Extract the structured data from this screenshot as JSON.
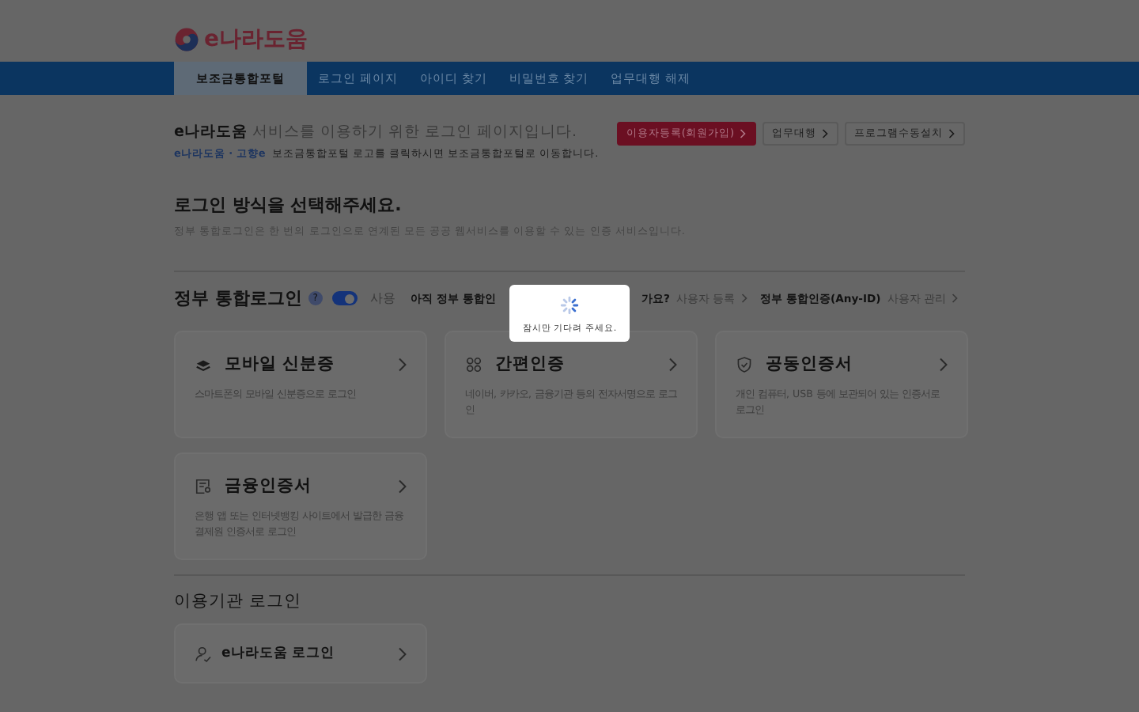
{
  "logo": {
    "text": "e나라도움"
  },
  "nav": {
    "tabs": [
      {
        "label": "보조금통합포털",
        "selected": true
      },
      {
        "label": "로그인 페이지",
        "selected": false
      },
      {
        "label": "아이디 찾기",
        "selected": false
      },
      {
        "label": "비밀번호 찾기",
        "selected": false
      },
      {
        "label": "업무대행 해제",
        "selected": false
      }
    ]
  },
  "intro": {
    "title_brand": "e나라도움",
    "title_rest": " 서비스를 이용하기 위한 로그인 페이지입니다.",
    "note_brand": "e나라도움 · 고향e",
    "note_rest": "보조금통합포털 로고를 클릭하시면 보조금통합포털로 이동합니다.",
    "buttons": [
      {
        "label": "이용자등록(회원가입)",
        "kind": "primary"
      },
      {
        "label": "업무대행",
        "kind": "plain"
      },
      {
        "label": "프로그램수동설치",
        "kind": "plain"
      }
    ]
  },
  "section": {
    "title": "로그인 방식을 선택해주세요.",
    "description": "정부 통합로그인은 한 번의 로그인으로 연계된 모든 공공 웹서비스를 이용할 수 있는 인증 서비스입니다."
  },
  "gov_login": {
    "title": "정부 통합로그인",
    "help": "?",
    "toggle_on": true,
    "toggle_label": "사용",
    "question_start": "아직 정부 통합인",
    "question_end": "가요?",
    "links": [
      {
        "label": "사용자 등록",
        "kind": "link"
      },
      {
        "label": "정부 통합인증(Any-ID)",
        "kind": "label"
      },
      {
        "label": "사용자 관리",
        "kind": "link"
      }
    ]
  },
  "methods": [
    {
      "kind": "mobile",
      "title": "모바일 신분증",
      "description": "스마트폰의 모바일 신분증으로 로그인"
    },
    {
      "kind": "simple",
      "title": "간편인증",
      "description": "네이버, 카카오, 금융기관 등의 전자서명으로 로그인"
    },
    {
      "kind": "joint",
      "title": "공동인증서",
      "description": "개인 컴퓨터, USB 등에 보관되어 있는 인증서로 로그인"
    },
    {
      "kind": "finance",
      "title": "금융인증서",
      "description": "은행 앱 또는 인터넷뱅킹 사이트에서 발급한 금융결제원 인증서로 로그인"
    }
  ],
  "agency": {
    "title": "이용기관 로그인",
    "button": "e나라도움 로그인"
  },
  "loading": {
    "message": "잠시만 기다려 주세요."
  }
}
